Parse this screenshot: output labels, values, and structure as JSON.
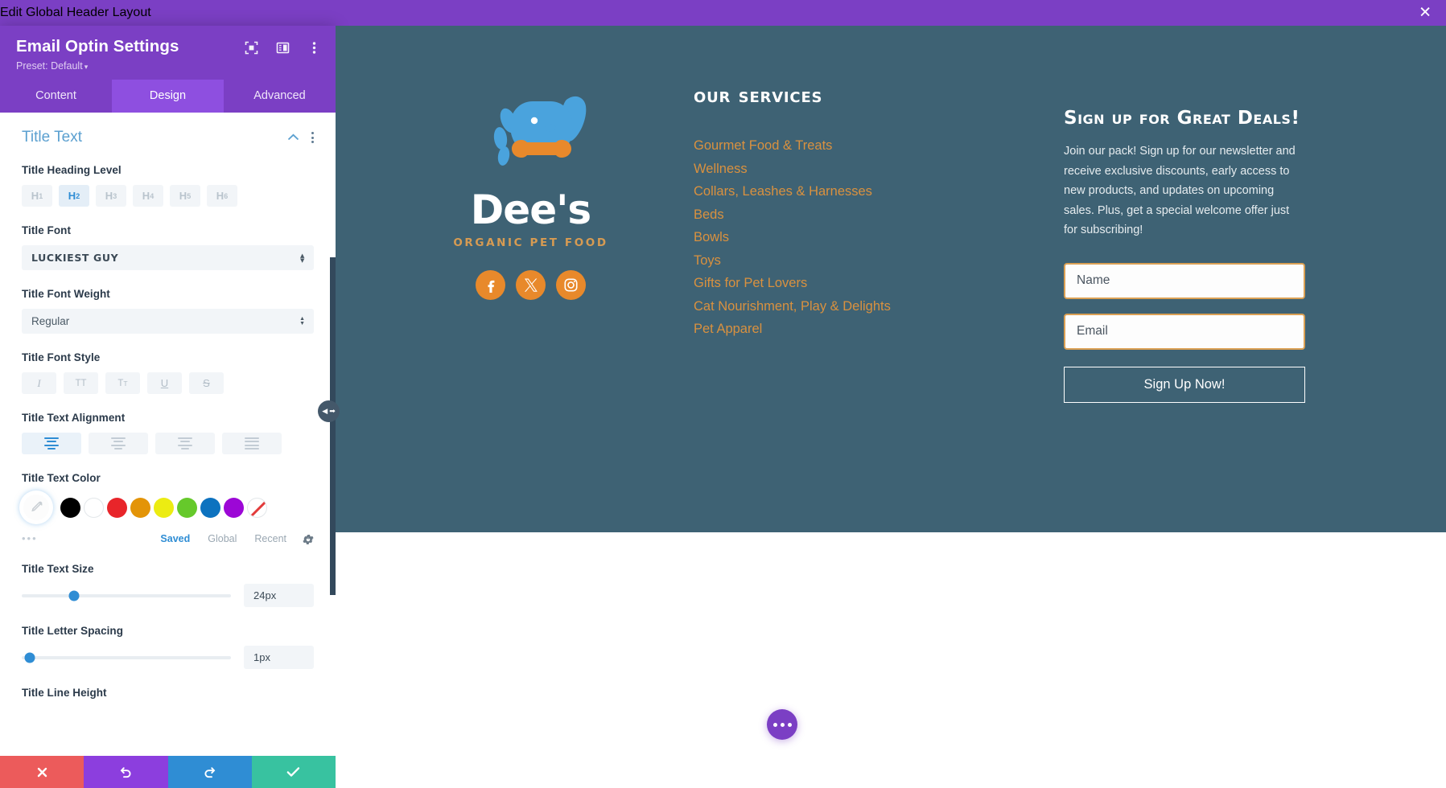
{
  "topbar": {
    "title": "Edit Global Header Layout",
    "close_icon": "close-icon",
    "close_label": "✕"
  },
  "panel": {
    "title": "Email Optin Settings",
    "preset_label": "Preset: Default",
    "preset_caret": "▾",
    "head_icons": [
      "target-focus-icon",
      "layout-panel-icon",
      "kebab-menu-icon"
    ],
    "tabs": [
      {
        "label": "Content",
        "active": false
      },
      {
        "label": "Design",
        "active": true
      },
      {
        "label": "Advanced",
        "active": false
      }
    ],
    "section": {
      "title": "Title Text",
      "collapse_icon": "chevron-up-icon",
      "menu_icon": "kebab-menu-icon"
    },
    "fields": {
      "heading_level": {
        "label": "Title Heading Level",
        "options": [
          "H1",
          "H2",
          "H3",
          "H4",
          "H5",
          "H6"
        ],
        "selected": "H2"
      },
      "font": {
        "label": "Title Font",
        "value": "Luckiest Guy"
      },
      "font_weight": {
        "label": "Title Font Weight",
        "value": "Regular"
      },
      "font_style": {
        "label": "Title Font Style",
        "options": [
          "I",
          "TT",
          "Tᴛ",
          "U",
          "S"
        ],
        "selected": null
      },
      "alignment": {
        "label": "Title Text Alignment",
        "options": [
          "left",
          "center",
          "right",
          "justify"
        ],
        "selected": "left"
      },
      "text_color": {
        "label": "Title Text Color",
        "picker_icon": "eyedropper-icon",
        "swatches": [
          "#000000",
          "#ffffff",
          "#e8252a",
          "#e39408",
          "#ecec12",
          "#66c92b",
          "#0d72bf",
          "#9c07d6",
          "none"
        ],
        "more_dots": "•••",
        "tabs": [
          {
            "label": "Saved",
            "active": true
          },
          {
            "label": "Global",
            "active": false
          },
          {
            "label": "Recent",
            "active": false
          }
        ],
        "gear_icon": "gear-icon"
      },
      "text_size": {
        "label": "Title Text Size",
        "value": "24px",
        "knob_percent": 25
      },
      "letter_spacing": {
        "label": "Title Letter Spacing",
        "value": "1px",
        "knob_percent": 4
      },
      "line_height": {
        "label": "Title Line Height"
      }
    },
    "footer": [
      {
        "name": "cancel-button",
        "icon": "close-icon",
        "color": "#ec5b5b"
      },
      {
        "name": "undo-button",
        "icon": "undo-icon",
        "color": "#8c3ede"
      },
      {
        "name": "redo-button",
        "icon": "redo-icon",
        "color": "#2f8dd4"
      },
      {
        "name": "save-button",
        "icon": "check-icon",
        "color": "#38c2a0"
      }
    ],
    "drag_handle": {
      "left_arrow": "◀",
      "right_arrow": "➡"
    }
  },
  "preview": {
    "background": "#3e6274",
    "brand": {
      "name": "Dee's",
      "tagline": "ORGANIC PET FOOD",
      "logo_icon": "dog-face-logo-icon",
      "logo_colors": {
        "dog": "#4aa3dd",
        "bone": "#e8892b"
      }
    },
    "socials": [
      {
        "name": "facebook-icon",
        "glyph": "f"
      },
      {
        "name": "x-twitter-icon",
        "glyph": "X"
      },
      {
        "name": "instagram-icon",
        "glyph": "IG"
      }
    ],
    "services": {
      "heading": "Our Services",
      "items": [
        "Gourmet Food & Treats",
        "Wellness",
        "Collars, Leashes & Harnesses",
        "Beds",
        "Bowls",
        "Toys",
        "Gifts for Pet Lovers",
        "Cat Nourishment, Play & Delights",
        "Pet Apparel"
      ]
    },
    "optin": {
      "heading": "Sign up for Great Deals!",
      "body": "Join our pack! Sign up for our newsletter and receive exclusive discounts, early access to new products, and updates on upcoming sales. Plus, get a special welcome offer just for subscribing!",
      "name_placeholder": "Name",
      "email_placeholder": "Email",
      "submit_label": "Sign Up Now!"
    },
    "fab": {
      "name": "more-options-fab",
      "icon": "three-dots-icon"
    }
  }
}
